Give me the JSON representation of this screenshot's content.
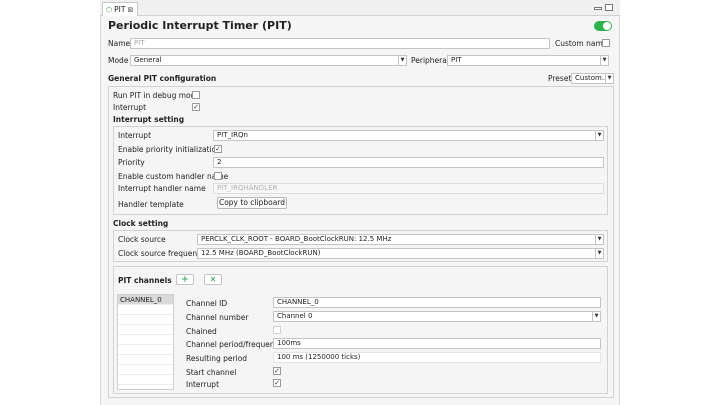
{
  "tab": {
    "label": "PIT",
    "close": "⊠"
  },
  "header": {
    "title": "Periodic Interrupt Timer (PIT)",
    "enabled": true
  },
  "top": {
    "name_label": "Name",
    "name_placeholder": "PIT",
    "custom_name_label": "Custom name",
    "mode_label": "Mode",
    "mode_value": "General",
    "peripheral_label": "Peripheral",
    "peripheral_value": "PIT"
  },
  "general": {
    "heading": "General PIT configuration",
    "preset_label": "Preset",
    "preset_value": "Custom...",
    "run_debug_label": "Run PIT in debug mode",
    "interrupt_label": "Interrupt"
  },
  "interrupt_setting": {
    "heading": "Interrupt setting",
    "interrupt_label": "Interrupt",
    "interrupt_value": "PIT_IRQn",
    "enable_priority_label": "Enable priority initialization",
    "priority_label": "Priority",
    "priority_value": "2",
    "enable_custom_handler_label": "Enable custom handler name",
    "handler_name_label": "Interrupt handler name",
    "handler_name_value": "PIT_IRQHANDLER",
    "handler_template_label": "Handler template",
    "copy_button": "Copy to clipboard"
  },
  "clock": {
    "heading": "Clock setting",
    "source_label": "Clock source",
    "source_value": "PERCLK_CLK_ROOT - BOARD_BootClockRUN: 12.5 MHz",
    "freq_label": "Clock source frequency",
    "freq_value": "12.5 MHz (BOARD_BootClockRUN)"
  },
  "channels": {
    "heading": "PIT channels",
    "add_icon": "+",
    "remove_icon": "✕",
    "list": [
      "CHANNEL_0"
    ],
    "id_label": "Channel ID",
    "id_value": "CHANNEL_0",
    "number_label": "Channel number",
    "number_value": "Channel 0",
    "chained_label": "Chained",
    "period_label": "Channel period/frequency",
    "period_value": "100ms",
    "resulting_label": "Resulting period",
    "resulting_value": "100 ms (1250000 ticks)",
    "start_label": "Start channel",
    "interrupt_label": "Interrupt"
  },
  "checkmark": "✓",
  "dropdown_arrow": "▼",
  "colors": {
    "toggle_on": "#2cb34a",
    "add_icon": "#2a9d4a",
    "remove_icon": "#2a9d4a"
  }
}
